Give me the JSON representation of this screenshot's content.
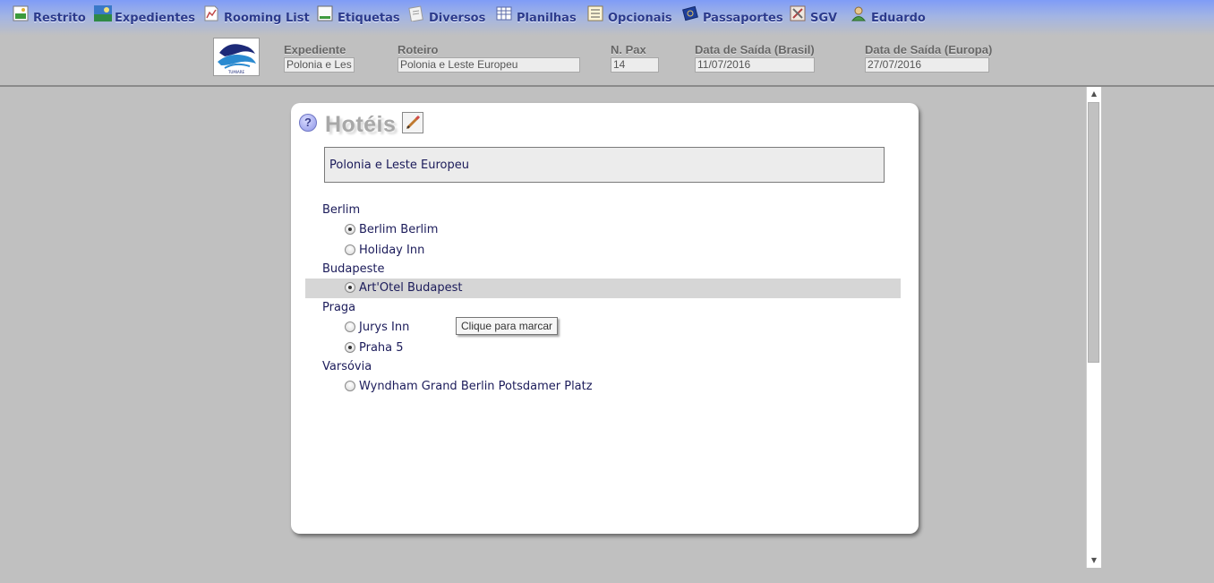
{
  "menu": {
    "items": [
      {
        "label": "Restrito",
        "icon": "image-icon"
      },
      {
        "label": "Expedientes",
        "icon": "landscape-icon"
      },
      {
        "label": "Rooming List",
        "icon": "document-chart-icon"
      },
      {
        "label": "Etiquetas",
        "icon": "label-icon"
      },
      {
        "label": "Diversos",
        "icon": "notes-icon"
      },
      {
        "label": "Planilhas",
        "icon": "spreadsheet-icon"
      },
      {
        "label": "Opcionais",
        "icon": "checklist-icon"
      },
      {
        "label": "Passaportes",
        "icon": "passport-icon"
      },
      {
        "label": "SGV",
        "icon": "tools-icon"
      },
      {
        "label": "Eduardo",
        "icon": "user-icon"
      }
    ]
  },
  "header": {
    "logo_text": "TUMIARE",
    "expediente": {
      "label": "Expediente",
      "value": "Polonia e Les"
    },
    "roteiro": {
      "label": "Roteiro",
      "value": "Polonia e Leste Europeu"
    },
    "npax": {
      "label": "N. Pax",
      "value": "14"
    },
    "saida_brasil": {
      "label": "Data de Saída (Brasil)",
      "value": "11/07/2016"
    },
    "saida_europa": {
      "label": "Data de Saída (Europa)",
      "value": "27/07/2016"
    }
  },
  "card": {
    "help_symbol": "?",
    "title": "Hotéis",
    "roteiro_name": "Polonia e Leste Europeu",
    "cities": [
      {
        "name": "Berlim",
        "hotels": [
          {
            "name": "Berlim Berlim",
            "checked": true
          },
          {
            "name": "Holiday Inn",
            "checked": false
          }
        ]
      },
      {
        "name": "Budapeste",
        "hotels": [
          {
            "name": "Art'Otel Budapest",
            "checked": true
          }
        ]
      },
      {
        "name": "Praga",
        "hotels": [
          {
            "name": "Jurys Inn",
            "checked": false
          },
          {
            "name": "Praha 5",
            "checked": true
          }
        ]
      },
      {
        "name": "Varsóvia",
        "hotels": [
          {
            "name": "Wyndham Grand Berlin Potsdamer Platz",
            "checked": false
          }
        ]
      }
    ],
    "tooltip": "Clique para marcar"
  },
  "colors": {
    "menu_text": "#2b3a8c",
    "page_background": "#c0c0c0",
    "row_highlight": "#d6d6d6",
    "list_text": "#1b1b5a"
  }
}
